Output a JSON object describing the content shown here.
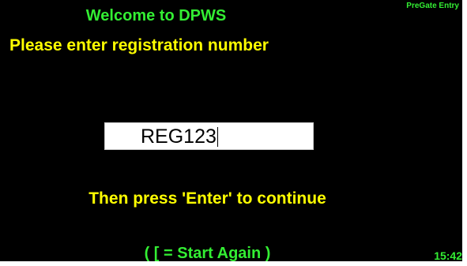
{
  "screen": {
    "title": "Welcome to DPWS",
    "mode_label": "PreGate Entry",
    "prompt": "Please enter registration number",
    "instruction": "Then press 'Enter' to continue",
    "restart_hint": "( [ = Start Again )",
    "clock": "15:42"
  },
  "registration_input": {
    "value": "REG123"
  },
  "colors": {
    "background": "#000000",
    "title_green": "#33ee33",
    "prompt_yellow": "#ffff00",
    "input_background": "#ffffff",
    "input_text": "#000000"
  }
}
